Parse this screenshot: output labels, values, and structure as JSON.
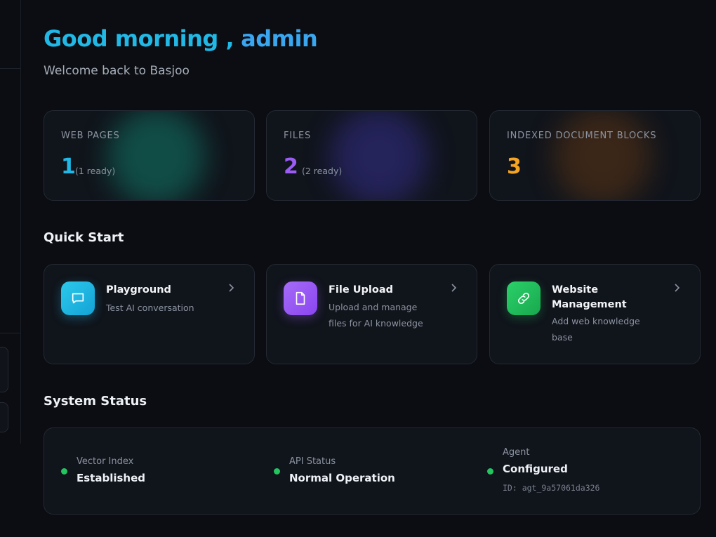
{
  "header": {
    "greeting": "Good morning ,",
    "user": "admin",
    "subtitle": "Welcome back to Basjoo"
  },
  "stats": [
    {
      "label": "WEB PAGES",
      "value": "1",
      "sub": "(1 ready)",
      "color": "#22b8e6"
    },
    {
      "label": "FILES",
      "value": "2",
      "sub": "(2 ready)",
      "color": "#9b5cf6"
    },
    {
      "label": "INDEXED DOCUMENT BLOCKS",
      "value": "3",
      "sub": "",
      "color": "#f5a524"
    }
  ],
  "quick_start": {
    "title": "Quick Start",
    "items": [
      {
        "title": "Playground",
        "desc": "Test AI conversation",
        "icon": "chat-icon",
        "color": "#22b8e6"
      },
      {
        "title": "File Upload",
        "desc": "Upload and manage files for AI knowledge",
        "icon": "file-icon",
        "color": "#9b5cf6"
      },
      {
        "title": "Website Management",
        "desc": "Add web knowledge base",
        "icon": "link-icon",
        "color": "#22c55e"
      }
    ]
  },
  "system_status": {
    "title": "System Status",
    "items": [
      {
        "label": "Vector Index",
        "value": "Established"
      },
      {
        "label": "API Status",
        "value": "Normal Operation"
      },
      {
        "label": "Agent",
        "value": "Configured",
        "id": "ID: agt_9a57061da326"
      }
    ],
    "status_color": "#22c55e"
  }
}
